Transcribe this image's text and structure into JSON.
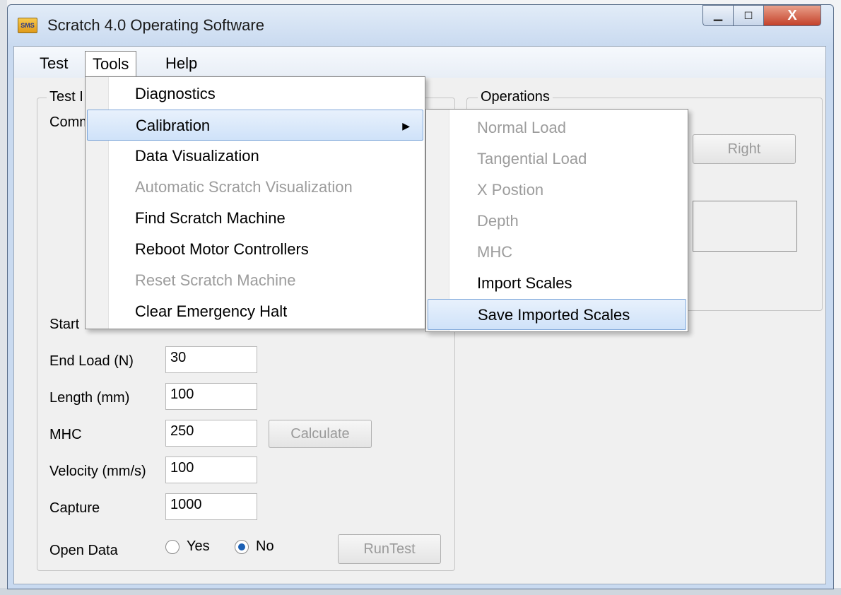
{
  "window": {
    "title": "Scratch 4.0 Operating Software",
    "icon_text": "SMS",
    "minimize_glyph": "▁",
    "maximize_glyph": "◻",
    "close_glyph": "X"
  },
  "menubar": {
    "items": [
      "Test",
      "Tools",
      "Help"
    ]
  },
  "tools_menu": {
    "items": [
      {
        "label": "Diagnostics",
        "enabled": true
      },
      {
        "label": "Calibration",
        "enabled": true,
        "submenu": true,
        "highlighted": true
      },
      {
        "label": "Data Visualization",
        "enabled": true
      },
      {
        "label": "Automatic Scratch Visualization",
        "enabled": false
      },
      {
        "label": "Find Scratch Machine",
        "enabled": true
      },
      {
        "label": "Reboot Motor Controllers",
        "enabled": true
      },
      {
        "label": "Reset Scratch Machine",
        "enabled": false
      },
      {
        "label": "Clear Emergency Halt",
        "enabled": true
      }
    ],
    "arrow_glyph": "▶"
  },
  "calibration_submenu": {
    "items": [
      {
        "label": "Normal Load",
        "enabled": false
      },
      {
        "label": "Tangential Load",
        "enabled": false
      },
      {
        "label": "X Postion",
        "enabled": false
      },
      {
        "label": "Depth",
        "enabled": false
      },
      {
        "label": "MHC",
        "enabled": false
      },
      {
        "label": "Import Scales",
        "enabled": true
      },
      {
        "label": "Save Imported Scales",
        "enabled": true,
        "highlighted": true
      }
    ]
  },
  "test_group": {
    "legend": "Test I",
    "comm_label": "Comm",
    "start_label": "Start",
    "fields": [
      {
        "label": "End Load (N)",
        "value": "30"
      },
      {
        "label": "Length (mm)",
        "value": "100"
      },
      {
        "label": "MHC",
        "value": "250"
      },
      {
        "label": "Velocity (mm/s)",
        "value": "100"
      },
      {
        "label": "Capture",
        "value": "1000"
      }
    ],
    "calculate_label": "Calculate",
    "open_data_label": "Open Data",
    "radio_yes": "Yes",
    "radio_no": "No",
    "selected_radio": "No",
    "run_test_label": "RunTest"
  },
  "operations_group": {
    "legend": "Operations",
    "right_button": "Right"
  }
}
